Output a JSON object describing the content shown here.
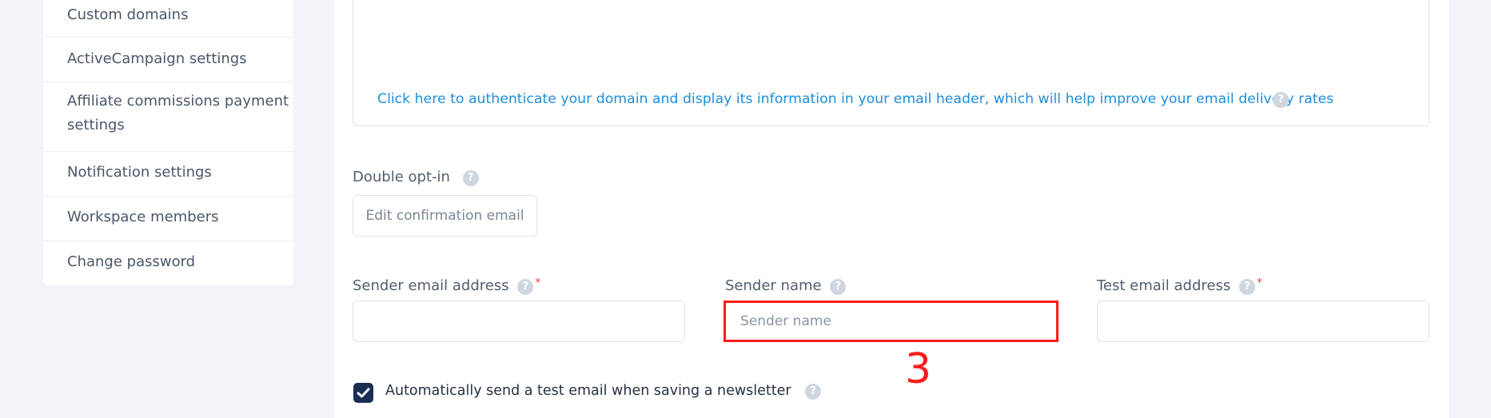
{
  "sidebar": {
    "items": [
      {
        "label": "Custom domains"
      },
      {
        "label": "ActiveCampaign settings"
      },
      {
        "label_line1": "Affiliate commissions payment",
        "label_line2": "settings"
      },
      {
        "label": "Notification settings"
      },
      {
        "label": "Workspace members"
      },
      {
        "label": "Change password"
      }
    ]
  },
  "domain_auth": {
    "link_text": "Click here to authenticate your domain and display its information in your email header, which will help improve your email delivery rates"
  },
  "double_optin": {
    "label": "Double opt-in",
    "button_label": "Edit confirmation email"
  },
  "fields": {
    "sender_email": {
      "label": "Sender email address",
      "required": "*",
      "value": ""
    },
    "sender_name": {
      "label": "Sender name",
      "placeholder": "Sender name",
      "value": ""
    },
    "test_email": {
      "label": "Test email address",
      "required": "*",
      "value": ""
    }
  },
  "annotation": {
    "marker": "3"
  },
  "auto_test": {
    "checked": true,
    "label": "Automatically send a test email when saving a newsletter"
  },
  "icons": {
    "help": "help-circle-icon",
    "check": "checkmark-icon"
  },
  "colors": {
    "link": "#1e8fdb",
    "checkbox": "#1c2d55",
    "highlight": "#ff1a1a",
    "required": "#e53e3e"
  }
}
